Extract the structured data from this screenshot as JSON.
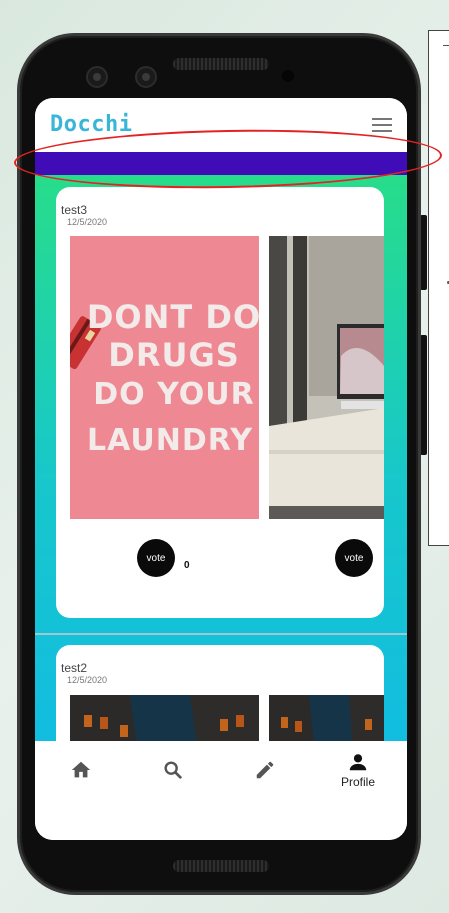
{
  "app": {
    "title": "Docchi"
  },
  "posts": [
    {
      "author": "test3",
      "date": "12/5/2020",
      "vote_label": "vote",
      "vote_count": "0",
      "second_vote_label": "vote",
      "image_left_text": [
        "DONT DO",
        "DRUGS",
        "DO YOUR",
        "LAUNDRY"
      ]
    },
    {
      "author": "test2",
      "date": "12/5/2020"
    }
  ],
  "bottom_nav": {
    "items": [
      {
        "icon": "home-icon",
        "label": ""
      },
      {
        "icon": "search-icon",
        "label": ""
      },
      {
        "icon": "pencil-icon",
        "label": ""
      },
      {
        "icon": "person-icon",
        "label": "Profile"
      }
    ]
  },
  "colors": {
    "accent_title": "#37b6d8",
    "purple_bar": "#3f0cb8",
    "gradient_top": "#27dd8a",
    "gradient_bottom": "#12bde0",
    "annotation_oval": "#e52222"
  }
}
